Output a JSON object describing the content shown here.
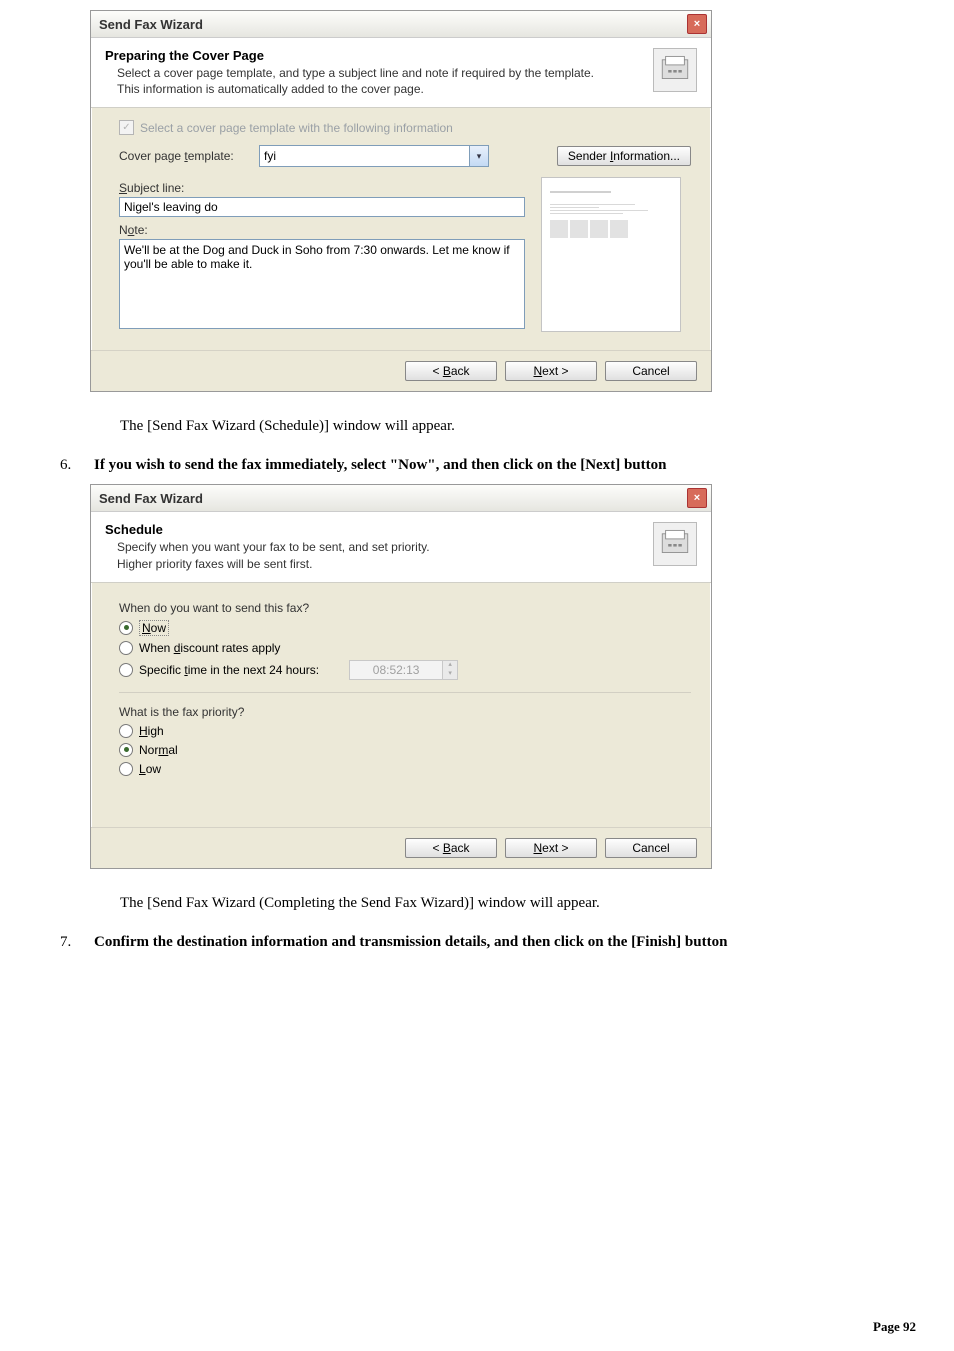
{
  "dialog1": {
    "title": "Send Fax Wizard",
    "header_title": "Preparing the Cover Page",
    "header_sub1": "Select a cover page template, and type a subject line and note if required by the template.",
    "header_sub2": "This information is automatically added to the cover page.",
    "checkbox_label": "Select a cover page template with the following information",
    "cover_label": "Cover page template:",
    "cover_value": "fyi",
    "sender_btn": "Sender Information...",
    "subject_label": "Subject line:",
    "subject_value": "Nigel's leaving do",
    "note_label": "Note:",
    "note_value": "We'll be at the Dog and Duck in Soho from 7:30 onwards. Let me know if you'll be able to make it.",
    "back": "< Back",
    "next": "Next >",
    "cancel": "Cancel"
  },
  "para1": "The [Send Fax Wizard (Schedule)] window will appear.",
  "step6": {
    "num": "6.",
    "text": "If you wish to send the fax immediately, select \"Now\", and then click on the [Next] button"
  },
  "dialog2": {
    "title": "Send Fax Wizard",
    "header_title": "Schedule",
    "header_sub1": "Specify when you want your fax to be sent, and set priority.",
    "header_sub2": "Higher priority faxes will be sent first.",
    "q1": "When do you want to send this fax?",
    "opt_now": "Now",
    "opt_discount": "When discount rates apply",
    "opt_specific": "Specific time in the next 24 hours:",
    "time_value": "08:52:13",
    "q2": "What is the fax priority?",
    "opt_high": "High",
    "opt_normal": "Normal",
    "opt_low": "Low",
    "back": "< Back",
    "next": "Next >",
    "cancel": "Cancel"
  },
  "para2": "The [Send Fax Wizard (Completing the Send Fax Wizard)] window will appear.",
  "step7": {
    "num": "7.",
    "text": "Confirm the destination information and transmission details, and then click on the [Finish] button"
  },
  "page_footer_label": "Page",
  "page_footer_num": "92"
}
